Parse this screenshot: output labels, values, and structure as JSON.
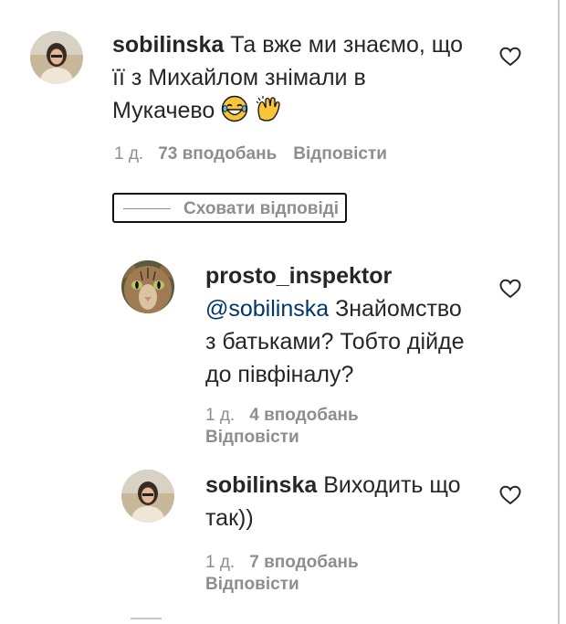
{
  "comments": [
    {
      "username": "sobilinska",
      "text_line1": " Та вже ми знаємо, що",
      "text_line2": "її з Михайлом знімали в",
      "text_line3": "Мукачево",
      "time": "1 д.",
      "likes": "73 вподобань",
      "reply": "Відповісти"
    }
  ],
  "replies_toggle": {
    "label": "Сховати відповіді"
  },
  "replies": [
    {
      "username": "prosto_inspektor",
      "mention": "@sobilinska",
      "text_line1": " Знайомство",
      "text_line2": "з батьками? Тобто дійде",
      "text_line3": "до півфіналу?",
      "time": "1 д.",
      "likes": "4 вподобань",
      "reply": "Відповісти"
    },
    {
      "username": "sobilinska",
      "text_line1": " Виходить що",
      "text_line2": "так))",
      "time": "1 д.",
      "likes": "7 вподобань",
      "reply": "Відповісти"
    }
  ],
  "icons": {
    "like": "heart-outline-icon",
    "emoji1": "grinning-tears-emoji",
    "emoji2": "clapping-hands-emoji"
  },
  "colors": {
    "text": "#262626",
    "secondary": "#8e8e8e",
    "mention": "#00376b"
  }
}
